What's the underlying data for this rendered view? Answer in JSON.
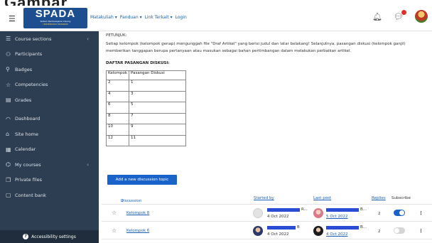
{
  "page_heading_fragment": "Gambar",
  "navbar": {
    "menu_icon": "hamburger-icon",
    "logo": {
      "title": "SPADA",
      "subtitle": "Sistem Pembelajaran Daring",
      "university": "UNIVERSITAS MATARAM"
    },
    "menu": [
      {
        "label": "Matakuliah",
        "caret": "▾"
      },
      {
        "label": "Panduan",
        "caret": "▾"
      },
      {
        "label": "Link Terkait",
        "caret": "▾"
      },
      {
        "label": "Login",
        "caret": ""
      }
    ],
    "icons": [
      "bell-icon",
      "chat-icon",
      "user-avatar"
    ]
  },
  "sidebar": {
    "items": [
      {
        "label": "Course sections",
        "icon": "list-icon",
        "has_chevron": true
      },
      {
        "label": "Participants",
        "icon": "users-icon",
        "has_chevron": false
      },
      {
        "label": "Badges",
        "icon": "badge-icon",
        "has_chevron": false
      },
      {
        "label": "Competencies",
        "icon": "star-icon",
        "has_chevron": false
      },
      {
        "label": "Grades",
        "icon": "table-icon",
        "has_chevron": false
      },
      {
        "label": "Dashboard",
        "icon": "gauge-icon",
        "has_chevron": false
      },
      {
        "label": "Site home",
        "icon": "home-icon",
        "has_chevron": false
      },
      {
        "label": "Calendar",
        "icon": "calendar-icon",
        "has_chevron": false
      },
      {
        "label": "My courses",
        "icon": "graduation-cap-icon",
        "has_chevron": true
      },
      {
        "label": "Private files",
        "icon": "files-icon",
        "has_chevron": false
      },
      {
        "label": "Content bank",
        "icon": "content-bank-icon",
        "has_chevron": false
      }
    ],
    "accessibility_label": "Accessibility settings"
  },
  "main": {
    "hint_label": "PETUNJUK:",
    "instructions": "Setiap kelompok (kelompok genap) mengunggah file \"Draf Artikel\" yang berisi judul dan latar belakang! Selanjutnya, pasangan diskusi (kelompok ganjil) memberikan tanggapan berupa pertanyaan atau masukan sebagai bahan pertimbangan dalam melakukan perbaikan artikel.",
    "pairs_heading": "DAFTAR PASANGAN DISKUSI:",
    "pairs_table": {
      "headers": [
        "Kelompok",
        "Pasangan Diskusi"
      ],
      "rows": [
        [
          "2",
          "1"
        ],
        [
          "4",
          "3"
        ],
        [
          "6",
          "5"
        ],
        [
          "8",
          "7"
        ],
        [
          "10",
          "9"
        ],
        [
          "12",
          "11"
        ]
      ]
    },
    "add_button": "Add a new discussion topic",
    "discussion_table": {
      "headers": {
        "discussion": "Discussion",
        "sort_indicator": "↓",
        "started_by": "Started by",
        "last_post": "Last post",
        "replies": "Replies",
        "subscribe": "Subscribe"
      },
      "rows": [
        {
          "topic": "Kelompok 8",
          "started_date": "4 Oct 2022",
          "last_post_date": "5 Oct 2022",
          "replies": "2",
          "subscribed": true,
          "name_fragment": "R...",
          "last_name_fragment": "B..."
        },
        {
          "topic": "Kelompok 6",
          "started_date": "4 Oct 2022",
          "last_post_date": "4 Oct 2022",
          "replies": "2",
          "subscribed": false,
          "name_fragment": "B",
          "last_name_fragment": "B..."
        }
      ]
    }
  },
  "colors": {
    "sidebar_bg": "#2d3e52",
    "accent_blue": "#1a63c9",
    "link": "#1a5fb4",
    "notification": "#e0302b",
    "toggle_on": "#1a63c9",
    "toggle_off": "#d5d5d5"
  }
}
